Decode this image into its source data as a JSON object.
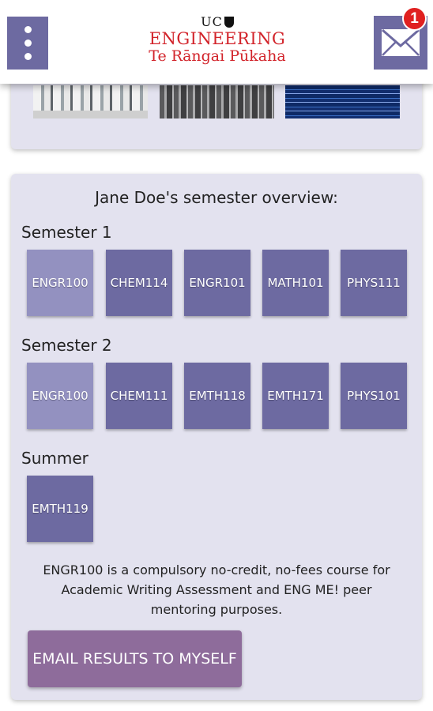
{
  "header": {
    "logo": {
      "uc": "UC",
      "line1": "ENGINEERING",
      "line2": "Te Rāngai Pūkaha"
    },
    "menu_icon": "vertical-dots-icon",
    "mail_icon": "envelope-icon",
    "notification_count": "1"
  },
  "overview": {
    "title": "Jane Doe's semester overview:",
    "semesters": [
      {
        "label": "Semester 1",
        "courses": [
          "ENGR100",
          "CHEM114",
          "ENGR101",
          "MATH101",
          "PHYS111"
        ]
      },
      {
        "label": "Semester 2",
        "courses": [
          "ENGR100",
          "CHEM111",
          "EMTH118",
          "EMTH171",
          "PHYS101"
        ]
      },
      {
        "label": "Summer",
        "courses": [
          "EMTH119"
        ]
      }
    ],
    "note": "ENGR100 is a compulsory no-credit, no-fees course for Academic Writing Assessment and ENG ME! peer mentoring purposes.",
    "email_button": "EMAIL RESULTS TO MYSELF"
  },
  "colors": {
    "primary": "#6d6aa1",
    "primary_light": "#9391c0",
    "card_bg": "#e3e2ef",
    "button": "#8e6c9b",
    "brand_red": "#d2232a",
    "badge": "#e02020"
  }
}
